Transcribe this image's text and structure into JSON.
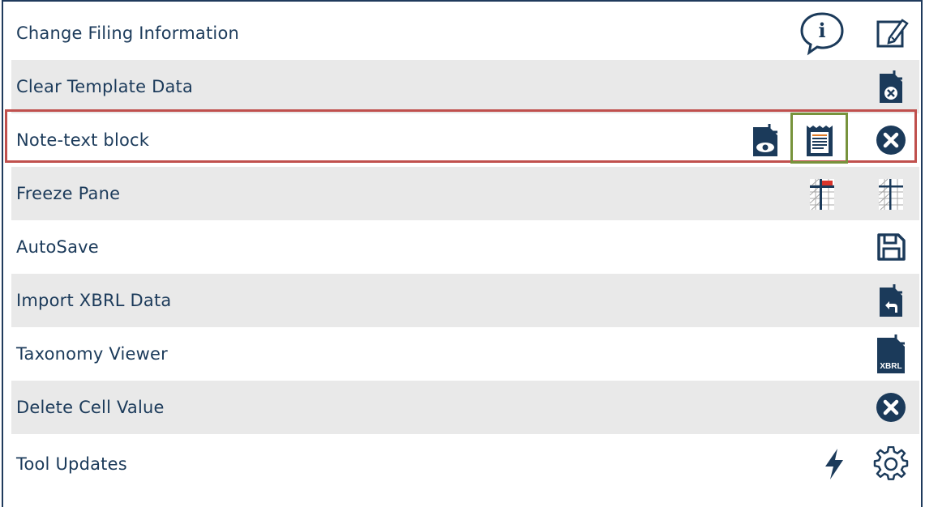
{
  "menu": {
    "items": [
      {
        "label": "Change Filing Information",
        "icons": [
          "info-bubble-icon",
          "edit-icon"
        ]
      },
      {
        "label": "Clear Template Data",
        "icons": [
          "clear-file-icon"
        ]
      },
      {
        "label": "Note-text block",
        "icons": [
          "preview-file-icon",
          "text-block-icon",
          "close-circle-icon"
        ]
      },
      {
        "label": "Freeze Pane",
        "icons": [
          "freeze-pane-icon",
          "unfreeze-pane-icon"
        ]
      },
      {
        "label": "AutoSave",
        "icons": [
          "save-icon"
        ]
      },
      {
        "label": "Import XBRL Data",
        "icons": [
          "import-file-icon"
        ]
      },
      {
        "label": "Taxonomy Viewer",
        "icons": [
          "xbrl-file-icon"
        ]
      },
      {
        "label": "Delete Cell Value",
        "icons": [
          "close-circle-icon"
        ]
      },
      {
        "label": "Tool Updates",
        "icons": [
          "lightning-icon",
          "gear-icon"
        ]
      }
    ],
    "xbrl_icon_text": "XBRL",
    "info_icon_text": "i"
  },
  "colors": {
    "navy": "#1b3a5a",
    "row_shade": "#e9e9e9",
    "highlight_red": "#c0504d",
    "highlight_green": "#77933c",
    "flag_red": "#d9342b"
  }
}
